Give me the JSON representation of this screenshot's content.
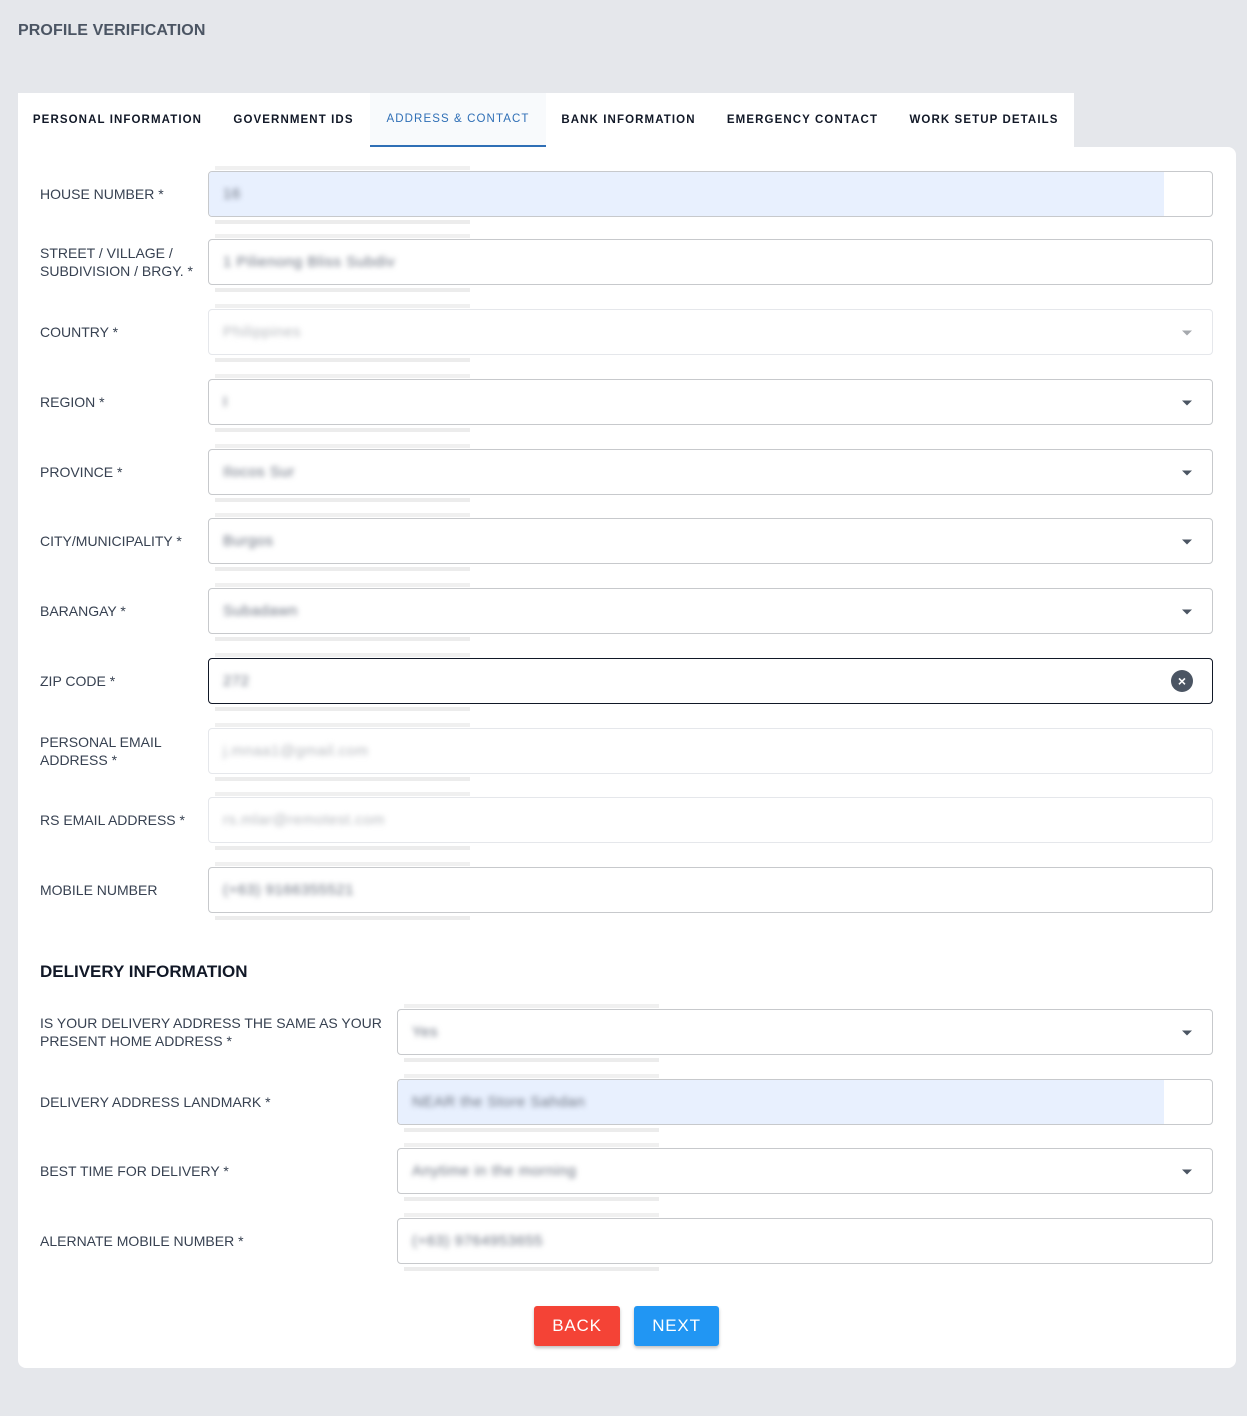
{
  "page": {
    "title": "PROFILE VERIFICATION"
  },
  "tabs": [
    {
      "label": "PERSONAL INFORMATION",
      "active": false
    },
    {
      "label": "GOVERNMENT IDS",
      "active": false
    },
    {
      "label": "ADDRESS & CONTACT",
      "active": true
    },
    {
      "label": "BANK INFORMATION",
      "active": false
    },
    {
      "label": "EMERGENCY CONTACT",
      "active": false
    },
    {
      "label": "WORK SETUP DETAILS",
      "active": false
    }
  ],
  "address": {
    "house_number": {
      "label": "HOUSE NUMBER *",
      "value": "16"
    },
    "street": {
      "label": "STREET / VILLAGE /\nSUBDIVISION / BRGY. *",
      "value": "1 Pilienong Bliss Subdiv"
    },
    "country": {
      "label": "COUNTRY *",
      "value": "Philippines"
    },
    "region": {
      "label": "REGION *",
      "value": "I"
    },
    "province": {
      "label": "PROVINCE *",
      "value": "Ilocos Sur"
    },
    "city": {
      "label": "CITY/MUNICIPALITY *",
      "value": "Burgos"
    },
    "barangay": {
      "label": "BARANGAY *",
      "value": "Subadawn"
    },
    "zip_code": {
      "label": "ZIP CODE *",
      "value": "272"
    },
    "personal_email": {
      "label": "PERSONAL EMAIL\nADDRESS *",
      "value": "j.mnaa1@gmail.com"
    },
    "rs_email": {
      "label": "RS EMAIL ADDRESS *",
      "value": "rs.mlar@remotest.com"
    },
    "mobile": {
      "label": "MOBILE NUMBER",
      "value": "(+63) 9166355521"
    }
  },
  "delivery": {
    "section_title": "DELIVERY INFORMATION",
    "same_address": {
      "label": "IS YOUR DELIVERY ADDRESS THE SAME AS YOUR\nPRESENT HOME ADDRESS *",
      "value": "Yes"
    },
    "landmark": {
      "label": "DELIVERY ADDRESS LANDMARK *",
      "value": "NEAR the Store Sahdan"
    },
    "best_time": {
      "label": "BEST TIME FOR DELIVERY *",
      "value": "Anytime in the morning"
    },
    "alt_mobile": {
      "label": "ALERNATE MOBILE NUMBER *",
      "value": "(+63) 9764953655"
    }
  },
  "buttons": {
    "back": "BACK",
    "next": "NEXT"
  },
  "colors": {
    "accent": "#2f6fb6",
    "back": "#f44336",
    "next": "#2196f3",
    "autofill": "#e8f0fe"
  },
  "icons": {
    "dropdown": "chevron-down-icon",
    "clear": "clear-circle-icon"
  }
}
